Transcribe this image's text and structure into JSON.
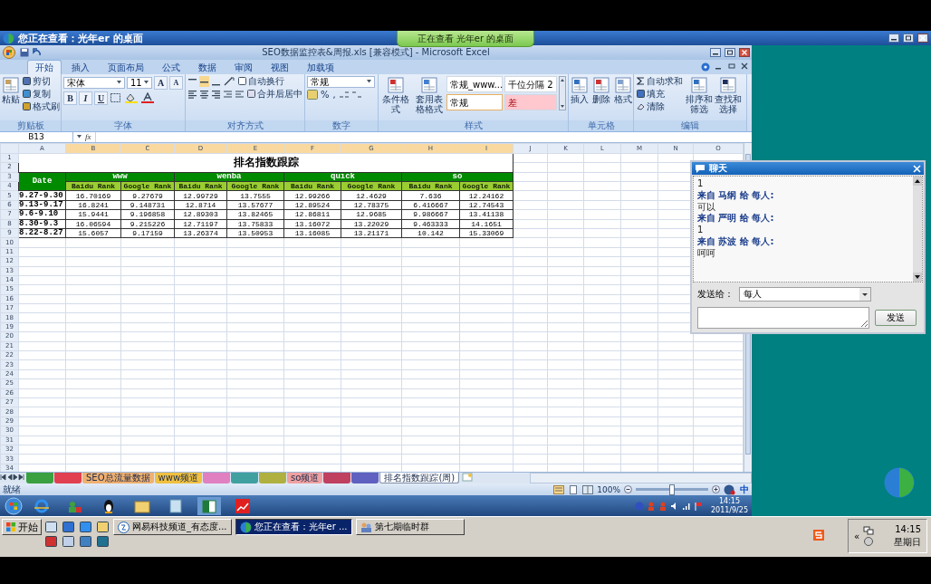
{
  "viewer": {
    "title": "您正在查看：光年er 的桌面",
    "banner": "正在查看 光年er 的桌面"
  },
  "excel": {
    "title": "SEO数据监控表&周报.xls  [兼容模式] - Microsoft Excel",
    "tabs": [
      {
        "label": "开始",
        "selected": true
      },
      {
        "label": "插入",
        "selected": false
      },
      {
        "label": "页面布局",
        "selected": false
      },
      {
        "label": "公式",
        "selected": false
      },
      {
        "label": "数据",
        "selected": false
      },
      {
        "label": "审阅",
        "selected": false
      },
      {
        "label": "视图",
        "selected": false
      },
      {
        "label": "加载项",
        "selected": false
      }
    ],
    "ribbon": [
      {
        "kind": "clipboard",
        "label": "剪贴板",
        "big": "粘贴",
        "items": [
          "剪切",
          "复制",
          "格式刷"
        ]
      },
      {
        "kind": "font",
        "label": "字体",
        "font": "宋体",
        "size": "11",
        "size_buttons": [
          "A",
          "A"
        ],
        "styles": [
          "B",
          "I",
          "U"
        ]
      },
      {
        "kind": "alignment",
        "label": "对齐方式",
        "items": [
          "自动换行",
          "合并后居中"
        ]
      },
      {
        "kind": "number",
        "label": "数字",
        "format": "常规",
        "symbols": [
          "%",
          ","
        ]
      },
      {
        "kind": "styles",
        "label": "样式",
        "buttons": [
          "条件格式",
          "套用表格格式"
        ],
        "cell_styles": [
          {
            "label": "常规_www...",
            "kind": "normal",
            "selected": false
          },
          {
            "label": "千位分隔 2",
            "kind": "normal",
            "selected": false
          },
          {
            "label": "常规",
            "kind": "normal",
            "selected": true
          },
          {
            "label": "差",
            "kind": "bad",
            "selected": false
          }
        ]
      },
      {
        "kind": "cells",
        "label": "单元格",
        "buttons": [
          "插入",
          "删除",
          "格式"
        ]
      },
      {
        "kind": "editing",
        "label": "编辑",
        "items": [
          "自动求和",
          "填充",
          "清除"
        ],
        "buttons": [
          "排序和筛选",
          "查找和选择"
        ]
      }
    ],
    "formula_bar": {
      "name_box": "B13",
      "function_label": "fx"
    },
    "sheet": {
      "columns": [
        {
          "letter": "A",
          "highlighted": false
        },
        {
          "letter": "B",
          "highlighted": true
        },
        {
          "letter": "C",
          "highlighted": true
        },
        {
          "letter": "D",
          "highlighted": true
        },
        {
          "letter": "E",
          "highlighted": true
        },
        {
          "letter": "F",
          "highlighted": true
        },
        {
          "letter": "G",
          "highlighted": true
        },
        {
          "letter": "H",
          "highlighted": true
        },
        {
          "letter": "I",
          "highlighted": true
        },
        {
          "letter": "J",
          "highlighted": false
        },
        {
          "letter": "K",
          "highlighted": false
        },
        {
          "letter": "L",
          "highlighted": false
        },
        {
          "letter": "M",
          "highlighted": false
        },
        {
          "letter": "N",
          "highlighted": false
        },
        {
          "letter": "O",
          "highlighted": false
        }
      ],
      "row_numbers": [
        "1",
        "2",
        "3",
        "4",
        "5",
        "6",
        "7",
        "8",
        "9",
        "10",
        "11",
        "12",
        "13",
        "14",
        "15",
        "16",
        "17",
        "18",
        "19",
        "20",
        "21",
        "22",
        "23",
        "24",
        "25",
        "26",
        "27",
        "28",
        "29",
        "30",
        "31",
        "32",
        "33",
        "34"
      ],
      "title": "排名指数跟踪",
      "date_header": "Date",
      "groups": [
        "www",
        "wenba",
        "quick",
        "so"
      ],
      "subheaders": [
        "Baidu Rank",
        "Google Rank",
        "Baidu Rank",
        "Google Rank",
        "Baidu Rank",
        "Google Rank",
        "Baidu Rank",
        "Google Rank"
      ],
      "rows": [
        {
          "date": "9.27-9.30",
          "values": [
            "16.70169",
            "9.27679",
            "12.99729",
            "13.7555",
            "12.99266",
            "12.4629",
            "7.636",
            "12.24162"
          ]
        },
        {
          "date": "9.13-9.17",
          "values": [
            "16.8241",
            "9.148731",
            "12.8714",
            "13.57677",
            "12.89524",
            "12.78375",
            "6.416667",
            "12.74543"
          ]
        },
        {
          "date": "9.6-9.10",
          "values": [
            "15.9441",
            "9.196858",
            "12.89303",
            "13.82465",
            "12.86811",
            "12.9685",
            "9.986667",
            "13.41138"
          ]
        },
        {
          "date": "8.30-9.3",
          "values": [
            "16.06594",
            "9.215226",
            "12.71197",
            "13.75833",
            "13.16072",
            "13.22029",
            "9.463333",
            "14.1651"
          ]
        },
        {
          "date": "8.22-8.27",
          "values": [
            "15.6057",
            "9.17159",
            "13.26374",
            "13.50953",
            "13.16085",
            "13.21171",
            "10.142",
            "15.33069"
          ]
        }
      ]
    },
    "sheet_tabs": [
      {
        "color": "#3aa040",
        "selected": false
      },
      {
        "color": "#e04050",
        "selected": false
      },
      {
        "label": "SEO总流量数据",
        "color": "#f0b070",
        "selected": false
      },
      {
        "label": "www频道",
        "color": "#f0c040",
        "selected": false
      },
      {
        "color": "#e080c0",
        "selected": false
      },
      {
        "color": "#40a0a0",
        "selected": false
      },
      {
        "color": "#b0b040",
        "selected": false
      },
      {
        "label": "so频道",
        "color": "#f0a0a0",
        "selected": false
      },
      {
        "color": "#c04060",
        "selected": false
      },
      {
        "color": "#6060c0",
        "selected": false
      },
      {
        "label": "排名指数跟踪(周)",
        "selected": true
      }
    ],
    "status": {
      "text": "就绪",
      "zoom": "100%",
      "zoom_slider": {
        "level": 0.5
      },
      "ime": "中"
    }
  },
  "chat": {
    "title": "聊天",
    "messages": [
      {
        "kind": "body",
        "text": "1"
      },
      {
        "kind": "sender",
        "text": "来自 马纲 给 每人:"
      },
      {
        "kind": "body",
        "text": "可以"
      },
      {
        "kind": "sender",
        "text": "来自 严明 给 每人:"
      },
      {
        "kind": "body",
        "text": "1"
      },
      {
        "kind": "sender",
        "text": "来自 苏波 给 每人:"
      },
      {
        "kind": "body",
        "text": "呵呵"
      }
    ],
    "send_to_label": "发送给：",
    "recipient": "每人",
    "send_button": "发送"
  },
  "remote_taskbar": {
    "time": "14:15",
    "date": "2011/9/25"
  },
  "local_taskbar": {
    "start": "开始",
    "tasks": [
      {
        "label": "网易科技频道_有态度...",
        "selected": false
      },
      {
        "label": "您正在查看：光年er ...",
        "selected": true
      },
      {
        "label": "第七期临时群",
        "selected": false
      }
    ],
    "chevron": "«",
    "time": "14:15",
    "day": "星期日"
  }
}
